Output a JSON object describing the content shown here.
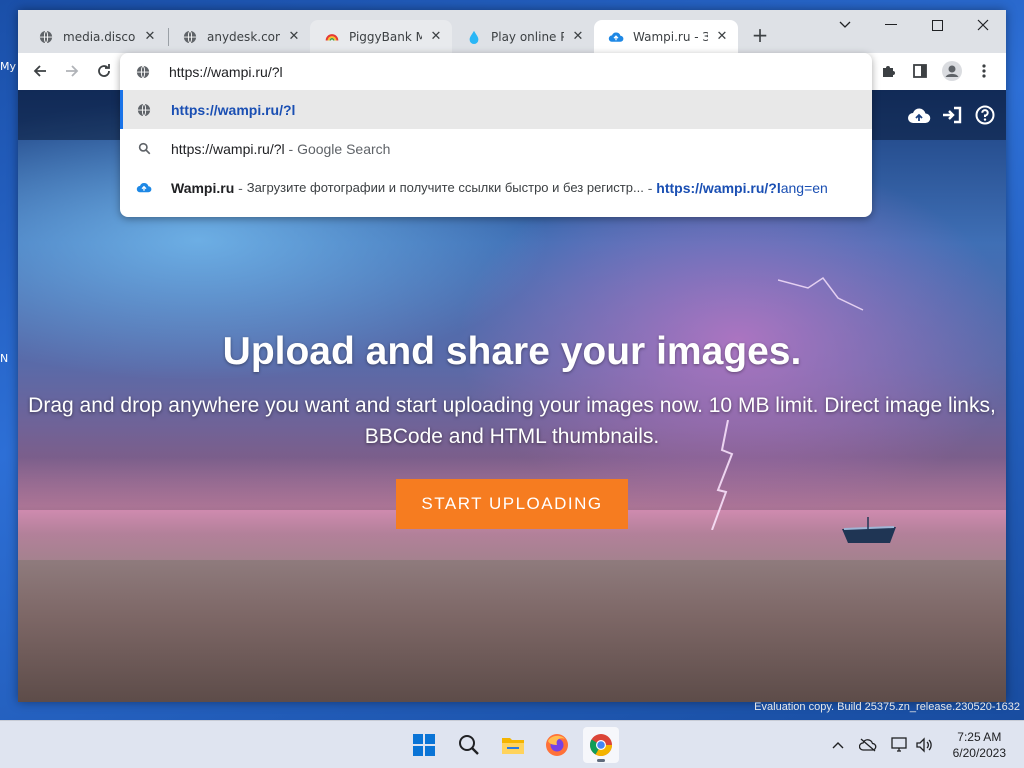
{
  "desktop": {
    "label_top": "My",
    "label_mid": "N"
  },
  "tabs": [
    {
      "title": "media.discordapp.net",
      "icon": "globe-icon"
    },
    {
      "title": "anydesk.com",
      "icon": "globe-icon"
    },
    {
      "title": "PiggyBank Money",
      "icon": "piggybank-icon"
    },
    {
      "title": "Play online PiggyBank",
      "icon": "droplet-icon"
    },
    {
      "title": "Wampi.ru - Загрузка",
      "icon": "cloud-upload-icon"
    }
  ],
  "new_tab_label": "+",
  "omnibox": {
    "value": "https://wampi.ru/?l",
    "suggestions": [
      {
        "url": "https://wampi.ru/?l"
      },
      {
        "query": "https://wampi.ru/?l",
        "separator": " - ",
        "engine": "Google Search"
      },
      {
        "site": "Wampi.ru",
        "separator": " - ",
        "description": "Загрузите фотографии и получите ссылки быстро и без регистр...",
        "dash": " - ",
        "url_bold": "https://wampi.ru/?l",
        "url_rest": "ang=en"
      }
    ]
  },
  "hero": {
    "title": "Upload and share your images.",
    "subtitle": "Drag and drop anywhere you want and start uploading your images now. 10 MB limit. Direct image links, BBCode and HTML thumbnails.",
    "cta": "START UPLOADING"
  },
  "watermark": "Evaluation copy. Build 25375.zn_release.230520-1632",
  "clock": {
    "time": "7:25 AM",
    "date": "6/20/2023"
  },
  "colors": {
    "accent": "#f67c20",
    "link": "#1a4fb3",
    "chrome_bg": "#dee1e6"
  }
}
